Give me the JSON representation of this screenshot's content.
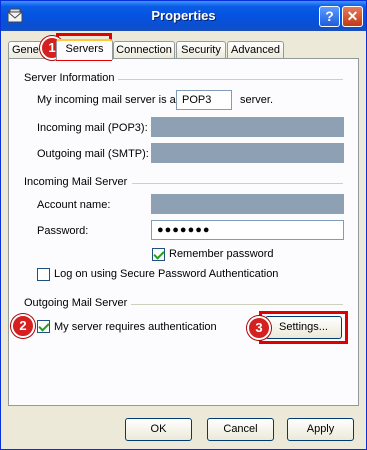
{
  "window": {
    "title": "Properties",
    "help_glyph": "?",
    "close_glyph": "✕"
  },
  "tabs": [
    {
      "label": "General",
      "shown": "Gene"
    },
    {
      "label": "Servers"
    },
    {
      "label": "Connection"
    },
    {
      "label": "Security"
    },
    {
      "label": "Advanced"
    }
  ],
  "server_info": {
    "heading": "Server Information",
    "incoming_type_prefix": "My incoming mail server is a",
    "incoming_type_value": "POP3",
    "incoming_type_suffix": "server.",
    "incoming_label": "Incoming mail (POP3):",
    "outgoing_label": "Outgoing mail (SMTP):"
  },
  "incoming_server": {
    "heading": "Incoming Mail Server",
    "account_label": "Account name:",
    "password_label": "Password:",
    "password_value": "●●●●●●●",
    "remember_label": "Remember password",
    "remember_checked": true,
    "spa_label": "Log on using Secure Password Authentication",
    "spa_checked": false
  },
  "outgoing_server": {
    "heading": "Outgoing Mail Server",
    "auth_label": "My server requires authentication",
    "auth_checked": true,
    "settings_label": "Settings..."
  },
  "footer": {
    "ok_label": "OK",
    "cancel_label": "Cancel",
    "apply_label": "Apply"
  },
  "annotations": [
    "1",
    "2",
    "3"
  ],
  "colors": {
    "title_bar": "#0553e2",
    "highlight": "#e00000",
    "badge": "#d42020",
    "masked_field": "#8ea0b4"
  }
}
